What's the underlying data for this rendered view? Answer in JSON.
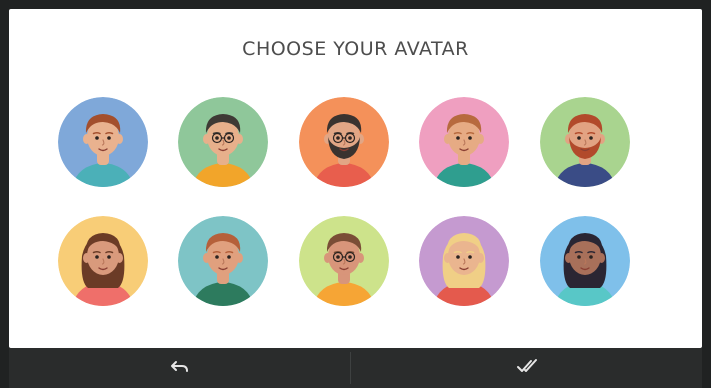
{
  "title": "CHOOSE YOUR AVATAR",
  "avatars": [
    {
      "bg": "#7fa8d9",
      "skin": "#e9b28f",
      "hair": "#a34f2d",
      "shirt": "#4bb0b8",
      "beard": "",
      "glasses": false
    },
    {
      "bg": "#8fc79a",
      "skin": "#e7b08b",
      "hair": "#3e3a35",
      "shirt": "#f2a52a",
      "beard": "",
      "glasses": true
    },
    {
      "bg": "#f4915a",
      "skin": "#e2a685",
      "hair": "#3a332f",
      "shirt": "#e85e4d",
      "beard": "#3a332f",
      "glasses": true
    },
    {
      "bg": "#ef9fc0",
      "skin": "#e6ab84",
      "hair": "#b76a3e",
      "shirt": "#2f9e8f",
      "beard": "",
      "glasses": false
    },
    {
      "bg": "#a9d48f",
      "skin": "#e2a383",
      "hair": "#b24a2b",
      "shirt": "#3a4c86",
      "beard": "#b24a2b",
      "glasses": false
    },
    {
      "bg": "#f8cd77",
      "skin": "#d99a7c",
      "hair": "#6b3b26",
      "shirt": "#ef6f6a",
      "beard": "",
      "glasses": false
    },
    {
      "bg": "#7ec4c6",
      "skin": "#e0a07e",
      "hair": "#b5603a",
      "shirt": "#2d7b5e",
      "beard": "",
      "glasses": false
    },
    {
      "bg": "#cde38b",
      "skin": "#d8957a",
      "hair": "#7a4d36",
      "shirt": "#f6a535",
      "beard": "",
      "glasses": true
    },
    {
      "bg": "#c59ad0",
      "skin": "#eab58f",
      "hair": "#f0cf86",
      "shirt": "#e45a4d",
      "beard": "",
      "glasses": false
    },
    {
      "bg": "#7fc0ea",
      "skin": "#a8705a",
      "hair": "#2a2633",
      "shirt": "#58c7c7",
      "beard": "",
      "glasses": false
    }
  ],
  "icons": {
    "back": "undo-arrow-icon",
    "confirm": "double-check-icon"
  },
  "colors": {
    "bar_bg": "#2a2c2c",
    "icon": "#e6e6e6"
  }
}
